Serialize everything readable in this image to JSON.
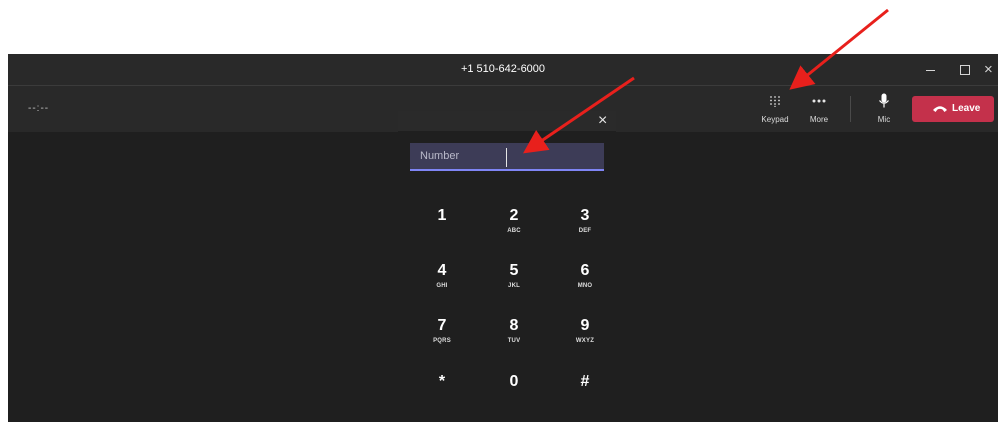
{
  "window": {
    "title": "+1 510-642-6000",
    "controls": {
      "minimize": "–",
      "maximize": "□",
      "close": "×"
    }
  },
  "toolbar": {
    "timer": "--:--",
    "keypad_label": "Keypad",
    "more_label": "More",
    "mic_label": "Mic",
    "leave_label": "Leave",
    "leave_color": "#c4314b",
    "icons": {
      "keypad": "keypad-grid-icon",
      "more": "more-dots-icon",
      "mic": "microphone-icon",
      "leave": "hang-up-phone-icon"
    }
  },
  "dialpad": {
    "close": "×",
    "input_placeholder": "Number",
    "input_value": "",
    "accent_color": "#7f85f5",
    "keys": [
      {
        "digit": "1",
        "letters": ""
      },
      {
        "digit": "2",
        "letters": "ABC"
      },
      {
        "digit": "3",
        "letters": "DEF"
      },
      {
        "digit": "4",
        "letters": "GHI"
      },
      {
        "digit": "5",
        "letters": "JKL"
      },
      {
        "digit": "6",
        "letters": "MNO"
      },
      {
        "digit": "7",
        "letters": "PQRS"
      },
      {
        "digit": "8",
        "letters": "TUV"
      },
      {
        "digit": "9",
        "letters": "WXYZ"
      },
      {
        "digit": "*",
        "letters": ""
      },
      {
        "digit": "0",
        "letters": ""
      },
      {
        "digit": "#",
        "letters": ""
      }
    ]
  },
  "annotations": {
    "arrow_color": "#e8201c"
  }
}
